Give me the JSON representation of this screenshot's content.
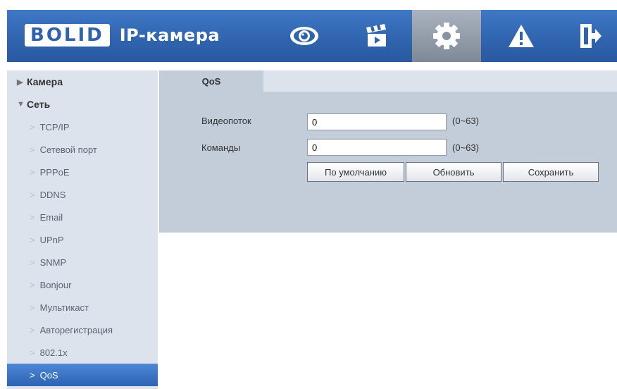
{
  "header": {
    "logo_text": "BOLID",
    "app_title": "IP-камера",
    "nav": [
      {
        "name": "live-view",
        "icon": "eye-icon"
      },
      {
        "name": "playback",
        "icon": "clapperboard-icon"
      },
      {
        "name": "settings",
        "icon": "gear-icon",
        "active": true
      },
      {
        "name": "alarm",
        "icon": "warning-icon"
      },
      {
        "name": "logout",
        "icon": "exit-icon"
      }
    ]
  },
  "sidebar": {
    "sections": [
      {
        "label": "Камера",
        "expanded": false
      },
      {
        "label": "Сеть",
        "expanded": true
      }
    ],
    "items": [
      {
        "label": "TCP/IP"
      },
      {
        "label": "Сетевой порт"
      },
      {
        "label": "PPPoE"
      },
      {
        "label": "DDNS"
      },
      {
        "label": "Email"
      },
      {
        "label": "UPnP"
      },
      {
        "label": "SNMP"
      },
      {
        "label": "Bonjour"
      },
      {
        "label": "Мультикаст"
      },
      {
        "label": "Авторегистрация"
      },
      {
        "label": "802.1x"
      },
      {
        "label": "QoS",
        "active": true
      }
    ]
  },
  "main": {
    "tab_label": "QoS",
    "fields": [
      {
        "label": "Видеопоток",
        "value": "0",
        "range": "(0~63)"
      },
      {
        "label": "Команды",
        "value": "0",
        "range": "(0~63)"
      }
    ],
    "buttons": {
      "default_label": "По умолчанию",
      "refresh_label": "Обновить",
      "save_label": "Сохранить"
    }
  },
  "colors": {
    "header_blue": "#2f63ad",
    "active_item": "#3a74c8",
    "panel_bg": "#c3ccd9",
    "sidebar_bg": "#dde3ec"
  }
}
